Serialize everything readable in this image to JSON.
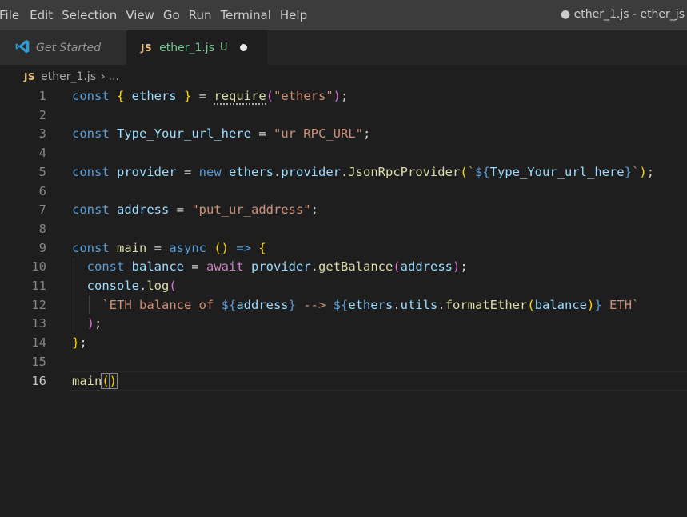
{
  "menubar": {
    "items": [
      "File",
      "Edit",
      "Selection",
      "View",
      "Go",
      "Run",
      "Terminal",
      "Help"
    ],
    "window_title": "● ether_1.js - ether_js"
  },
  "tabs": {
    "get_started": "Get Started",
    "active_badge": "JS",
    "active_file": "ether_1.js",
    "active_status": "U"
  },
  "breadcrumb": {
    "badge": "JS",
    "file": "ether_1.js",
    "separator": "›",
    "rest": "..."
  },
  "editor": {
    "line_numbers": [
      "1",
      "2",
      "3",
      "4",
      "5",
      "6",
      "7",
      "8",
      "9",
      "10",
      "11",
      "12",
      "13",
      "14",
      "15",
      "16"
    ],
    "current_line": 16,
    "lines": [
      [
        [
          "k",
          "const "
        ],
        [
          "b1",
          "{ "
        ],
        [
          "v",
          "ethers"
        ],
        [
          "b1",
          " }"
        ],
        [
          "p",
          " = "
        ],
        [
          "f",
          "require"
        ],
        [
          "b2",
          "("
        ],
        [
          "s",
          "\"ethers\""
        ],
        [
          "b2",
          ")"
        ],
        [
          "p",
          ";"
        ]
      ],
      [],
      [
        [
          "k",
          "const "
        ],
        [
          "v",
          "Type_Your_url_here"
        ],
        [
          "p",
          " = "
        ],
        [
          "s",
          "\"ur RPC_URL\""
        ],
        [
          "p",
          ";"
        ]
      ],
      [],
      [
        [
          "k",
          "const "
        ],
        [
          "v",
          "provider"
        ],
        [
          "p",
          " = "
        ],
        [
          "k",
          "new "
        ],
        [
          "v",
          "ethers"
        ],
        [
          "p",
          "."
        ],
        [
          "v",
          "provider"
        ],
        [
          "p",
          "."
        ],
        [
          "f",
          "JsonRpcProvider"
        ],
        [
          "b1",
          "("
        ],
        [
          "s",
          "`"
        ],
        [
          "k",
          "${"
        ],
        [
          "v",
          "Type_Your_url_here"
        ],
        [
          "k",
          "}"
        ],
        [
          "s",
          "`"
        ],
        [
          "b1",
          ")"
        ],
        [
          "p",
          ";"
        ]
      ],
      [],
      [
        [
          "k",
          "const "
        ],
        [
          "v",
          "address"
        ],
        [
          "p",
          " = "
        ],
        [
          "s",
          "\"put_ur_address\""
        ],
        [
          "p",
          ";"
        ]
      ],
      [],
      [
        [
          "k",
          "const "
        ],
        [
          "f",
          "main"
        ],
        [
          "p",
          " = "
        ],
        [
          "k",
          "async "
        ],
        [
          "b1",
          "()"
        ],
        [
          "p",
          " "
        ],
        [
          "k",
          "=>"
        ],
        [
          "p",
          " "
        ],
        [
          "b1",
          "{"
        ]
      ],
      [
        [
          "p",
          "  "
        ],
        [
          "k",
          "const "
        ],
        [
          "v",
          "balance"
        ],
        [
          "p",
          " = "
        ],
        [
          "kw2",
          "await "
        ],
        [
          "v",
          "provider"
        ],
        [
          "p",
          "."
        ],
        [
          "f",
          "getBalance"
        ],
        [
          "b2",
          "("
        ],
        [
          "v",
          "address"
        ],
        [
          "b2",
          ")"
        ],
        [
          "p",
          ";"
        ]
      ],
      [
        [
          "p",
          "  "
        ],
        [
          "v",
          "console"
        ],
        [
          "p",
          "."
        ],
        [
          "f",
          "log"
        ],
        [
          "b2",
          "("
        ]
      ],
      [
        [
          "p",
          "    "
        ],
        [
          "s",
          "`ETH balance of "
        ],
        [
          "k",
          "${"
        ],
        [
          "v",
          "address"
        ],
        [
          "k",
          "}"
        ],
        [
          "s",
          " --> "
        ],
        [
          "k",
          "${"
        ],
        [
          "v",
          "ethers"
        ],
        [
          "p",
          "."
        ],
        [
          "v",
          "utils"
        ],
        [
          "p",
          "."
        ],
        [
          "f",
          "formatEther"
        ],
        [
          "b1",
          "("
        ],
        [
          "v",
          "balance"
        ],
        [
          "b1",
          ")"
        ],
        [
          "k",
          "}"
        ],
        [
          "s",
          " ETH`"
        ]
      ],
      [
        [
          "p",
          "  "
        ],
        [
          "b2",
          ")"
        ],
        [
          "p",
          ";"
        ]
      ],
      [
        [
          "b1",
          "}"
        ],
        [
          "p",
          ";"
        ]
      ],
      [],
      [
        [
          "f",
          "main"
        ],
        [
          "b1",
          "("
        ],
        [
          "b1",
          ")"
        ]
      ]
    ]
  }
}
